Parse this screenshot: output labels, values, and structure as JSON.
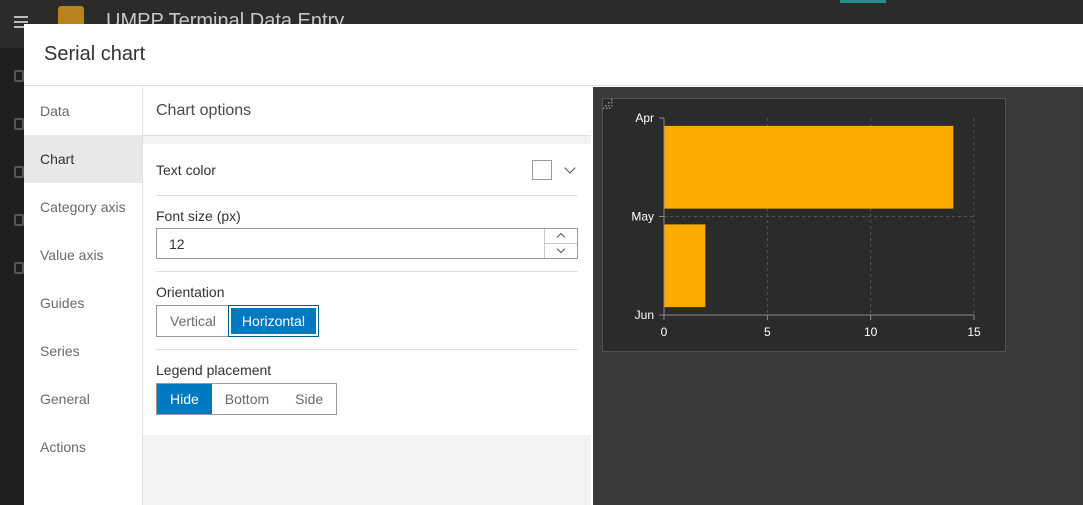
{
  "background_app": {
    "title": "UMPP Terminal Data Entry"
  },
  "modal": {
    "title": "Serial chart"
  },
  "nav": {
    "items": [
      {
        "label": "Data",
        "active": false
      },
      {
        "label": "Chart",
        "active": true
      },
      {
        "label": "Category axis",
        "active": false
      },
      {
        "label": "Value axis",
        "active": false
      },
      {
        "label": "Guides",
        "active": false
      },
      {
        "label": "Series",
        "active": false
      },
      {
        "label": "General",
        "active": false
      },
      {
        "label": "Actions",
        "active": false
      }
    ]
  },
  "options": {
    "heading": "Chart options",
    "text_color": {
      "label": "Text color",
      "value": "#ffffff"
    },
    "font_size": {
      "label": "Font size (px)",
      "value": "12"
    },
    "orientation": {
      "label": "Orientation",
      "options": [
        "Vertical",
        "Horizontal"
      ],
      "selected": "Horizontal"
    },
    "legend": {
      "label": "Legend placement",
      "options": [
        "Hide",
        "Bottom",
        "Side"
      ],
      "selected": "Hide"
    }
  },
  "colors": {
    "accent": "#0079c1",
    "bar": "#ffaa00",
    "chart_bg": "#2b2b2b"
  },
  "chart_data": {
    "type": "bar",
    "orientation": "horizontal",
    "categories": [
      "Apr",
      "May",
      "Jun"
    ],
    "values": [
      14,
      2
    ],
    "value_ticks": [
      0,
      5,
      10,
      15
    ],
    "xlim": [
      0,
      15
    ],
    "grid": true,
    "legend": "hidden"
  }
}
